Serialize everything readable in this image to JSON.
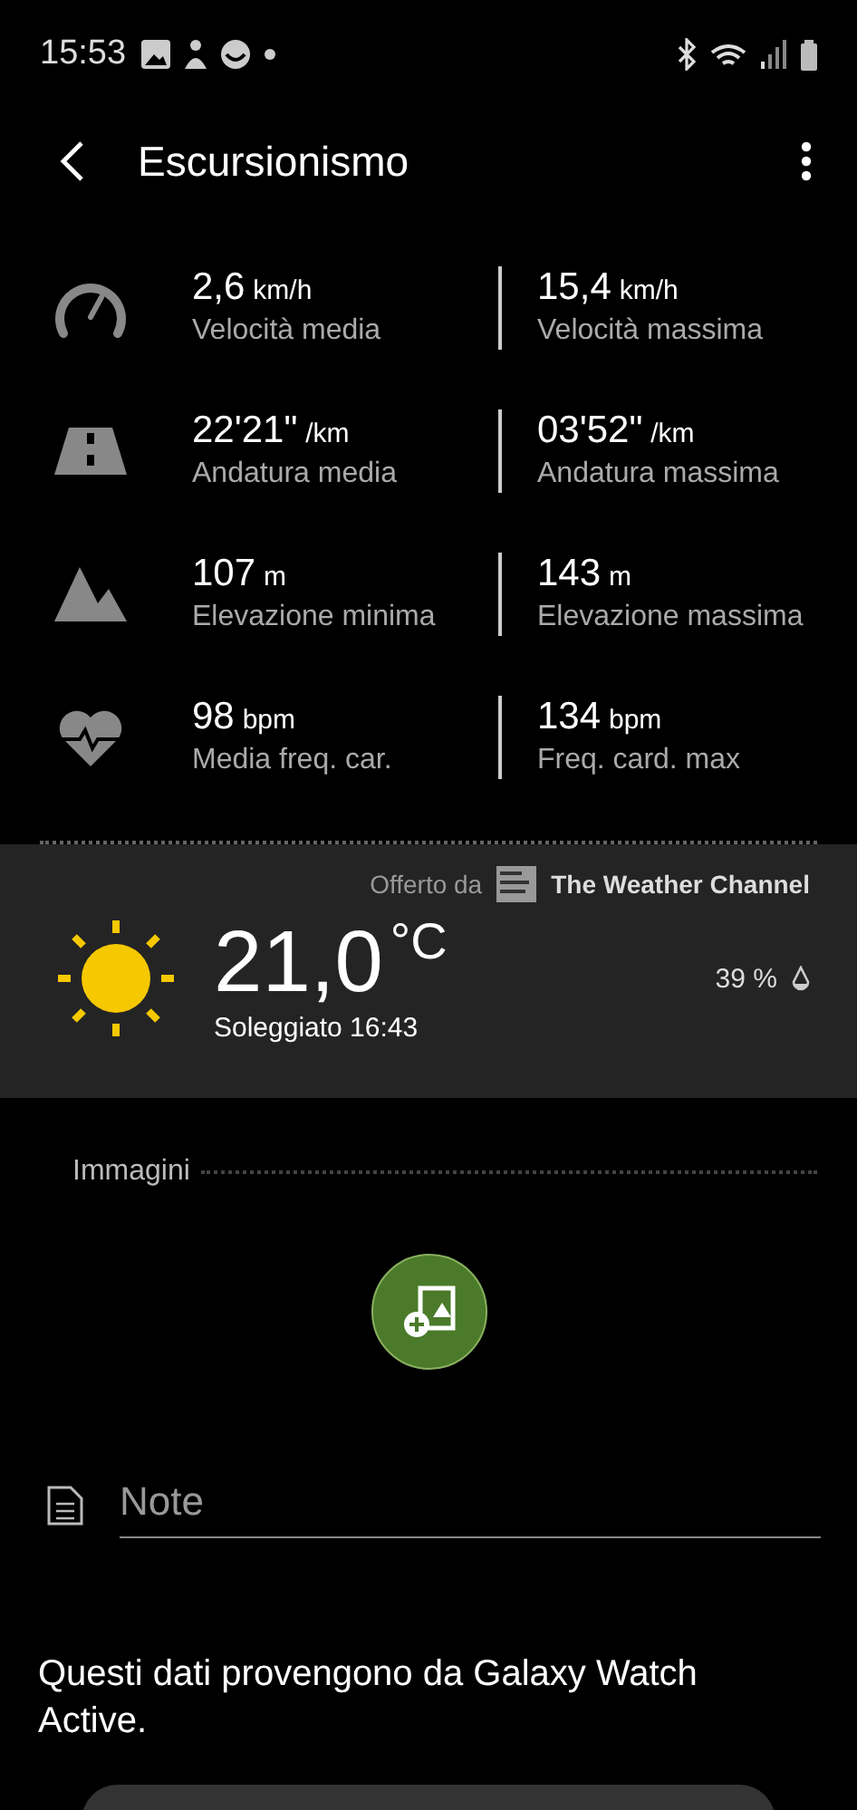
{
  "status_bar": {
    "time": "15:53"
  },
  "header": {
    "title": "Escursionismo"
  },
  "stats": [
    {
      "left": {
        "value": "2,6",
        "unit": "km/h",
        "label": "Velocità media"
      },
      "right": {
        "value": "15,4",
        "unit": "km/h",
        "label": "Velocità massima"
      }
    },
    {
      "left": {
        "value": "22'21\"",
        "unit": "/km",
        "label": "Andatura media"
      },
      "right": {
        "value": "03'52\"",
        "unit": "/km",
        "label": "Andatura massima"
      }
    },
    {
      "left": {
        "value": "107",
        "unit": "m",
        "label": "Elevazione minima"
      },
      "right": {
        "value": "143",
        "unit": "m",
        "label": "Elevazione massima"
      }
    },
    {
      "left": {
        "value": "98",
        "unit": "bpm",
        "label": "Media freq. car."
      },
      "right": {
        "value": "134",
        "unit": "bpm",
        "label": "Freq. card. max"
      }
    }
  ],
  "weather": {
    "offered_by": "Offerto da",
    "provider": "The Weather Channel",
    "temperature": "21,0",
    "unit": "°C",
    "condition": "Soleggiato 16:43",
    "humidity": "39 %"
  },
  "images": {
    "title": "Immagini"
  },
  "note": {
    "placeholder": "Note"
  },
  "source_text": "Questi dati provengono da Galaxy Watch Active."
}
